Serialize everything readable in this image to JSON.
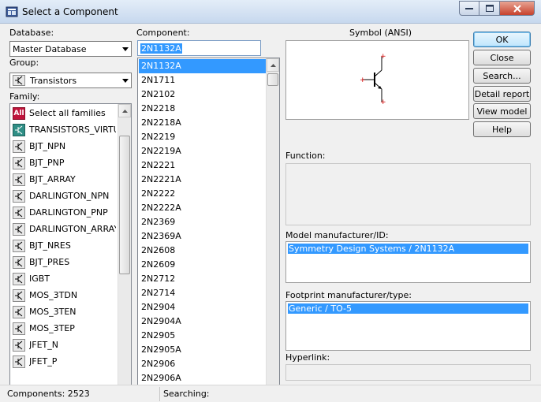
{
  "window": {
    "title": "Select a Component"
  },
  "database": {
    "label": "Database:",
    "value": "Master Database"
  },
  "group": {
    "label": "Group:",
    "value": "Transistors"
  },
  "family": {
    "label": "Family:",
    "items": [
      {
        "label": "Select all families",
        "icon": "all-families-icon",
        "badge": "All"
      },
      {
        "label": "TRANSISTORS_VIRTUAL",
        "icon": "virtual-transistor-icon"
      },
      {
        "label": "BJT_NPN",
        "icon": "bjt-npn-icon"
      },
      {
        "label": "BJT_PNP",
        "icon": "bjt-pnp-icon"
      },
      {
        "label": "BJT_ARRAY",
        "icon": "bjt-array-icon"
      },
      {
        "label": "DARLINGTON_NPN",
        "icon": "darlington-npn-icon"
      },
      {
        "label": "DARLINGTON_PNP",
        "icon": "darlington-pnp-icon"
      },
      {
        "label": "DARLINGTON_ARRAY",
        "icon": "darlington-array-icon"
      },
      {
        "label": "BJT_NRES",
        "icon": "bjt-nres-icon"
      },
      {
        "label": "BJT_PRES",
        "icon": "bjt-pres-icon"
      },
      {
        "label": "IGBT",
        "icon": "igbt-icon"
      },
      {
        "label": "MOS_3TDN",
        "icon": "mos-3tdn-icon"
      },
      {
        "label": "MOS_3TEN",
        "icon": "mos-3ten-icon"
      },
      {
        "label": "MOS_3TEP",
        "icon": "mos-3tep-icon"
      },
      {
        "label": "JFET_N",
        "icon": "jfet-n-icon"
      },
      {
        "label": "JFET_P",
        "icon": "jfet-p-icon"
      }
    ]
  },
  "component": {
    "label": "Component:",
    "search_value": "2N1132A",
    "selected": "2N1132A",
    "items": [
      "2N1132A",
      "2N1711",
      "2N2102",
      "2N2218",
      "2N2218A",
      "2N2219",
      "2N2219A",
      "2N2221",
      "2N2221A",
      "2N2222",
      "2N2222A",
      "2N2369",
      "2N2369A",
      "2N2608",
      "2N2609",
      "2N2712",
      "2N2714",
      "2N2904",
      "2N2904A",
      "2N2905",
      "2N2905A",
      "2N2906",
      "2N2906A"
    ]
  },
  "symbol": {
    "label": "Symbol (ANSI)"
  },
  "function": {
    "label": "Function:"
  },
  "model": {
    "label": "Model manufacturer/ID:",
    "value": "Symmetry Design Systems / 2N1132A"
  },
  "footprint": {
    "label": "Footprint manufacturer/type:",
    "value": "Generic / TO-5"
  },
  "hyperlink": {
    "label": "Hyperlink:"
  },
  "buttons": {
    "ok": "OK",
    "close": "Close",
    "search": "Search...",
    "detail_report": "Detail report",
    "view_model": "View model",
    "help": "Help"
  },
  "status": {
    "components": "Components: 2523",
    "searching": "Searching:"
  },
  "colors": {
    "selection": "#3399ff",
    "all_badge": "#c0143c",
    "virtual_icon": "#2f8f86"
  }
}
